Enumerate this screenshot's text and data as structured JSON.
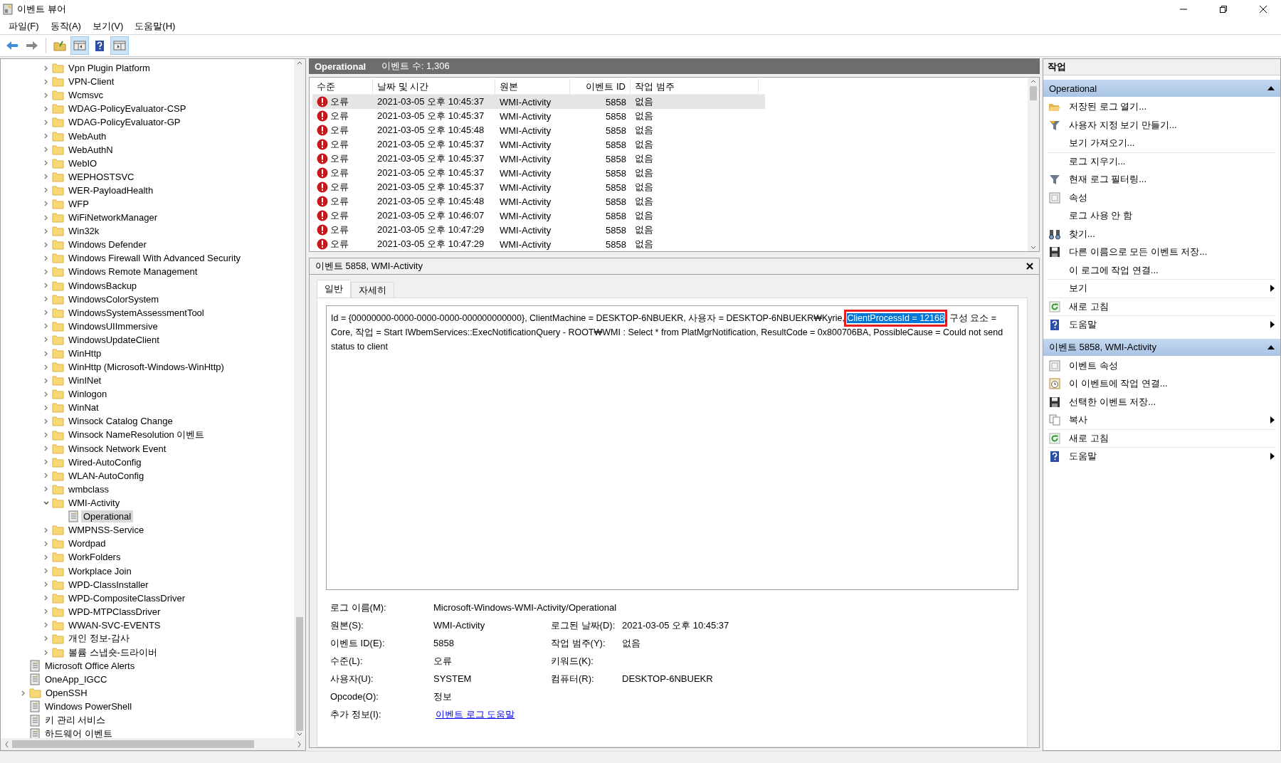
{
  "window": {
    "title": "이벤트 뷰어"
  },
  "menu": [
    "파일(F)",
    "동작(A)",
    "보기(V)",
    "도움말(H)"
  ],
  "toolbar": [
    {
      "kind": "back",
      "pressed": false
    },
    {
      "kind": "forward",
      "pressed": false
    },
    {
      "kind": "up",
      "pressed": false
    },
    {
      "kind": "tree-pane",
      "pressed": true
    },
    {
      "kind": "help",
      "pressed": false
    },
    {
      "kind": "action-pane",
      "pressed": true
    }
  ],
  "tree": {
    "nested_items": [
      {
        "label": "Vpn Plugin Platform",
        "kind": "folder",
        "expanded": false,
        "selected": false
      },
      {
        "label": "VPN-Client",
        "kind": "folder",
        "expanded": false,
        "selected": false
      },
      {
        "label": "Wcmsvc",
        "kind": "folder",
        "expanded": false,
        "selected": false
      },
      {
        "label": "WDAG-PolicyEvaluator-CSP",
        "kind": "folder",
        "expanded": false,
        "selected": false
      },
      {
        "label": "WDAG-PolicyEvaluator-GP",
        "kind": "folder",
        "expanded": false,
        "selected": false
      },
      {
        "label": "WebAuth",
        "kind": "folder",
        "expanded": false,
        "selected": false
      },
      {
        "label": "WebAuthN",
        "kind": "folder",
        "expanded": false,
        "selected": false
      },
      {
        "label": "WebIO",
        "kind": "folder",
        "expanded": false,
        "selected": false
      },
      {
        "label": "WEPHOSTSVC",
        "kind": "folder",
        "expanded": false,
        "selected": false
      },
      {
        "label": "WER-PayloadHealth",
        "kind": "folder",
        "expanded": false,
        "selected": false
      },
      {
        "label": "WFP",
        "kind": "folder",
        "expanded": false,
        "selected": false
      },
      {
        "label": "WiFiNetworkManager",
        "kind": "folder",
        "expanded": false,
        "selected": false
      },
      {
        "label": "Win32k",
        "kind": "folder",
        "expanded": false,
        "selected": false
      },
      {
        "label": "Windows Defender",
        "kind": "folder",
        "expanded": false,
        "selected": false
      },
      {
        "label": "Windows Firewall With Advanced Security",
        "kind": "folder",
        "expanded": false,
        "selected": false
      },
      {
        "label": "Windows Remote Management",
        "kind": "folder",
        "expanded": false,
        "selected": false
      },
      {
        "label": "WindowsBackup",
        "kind": "folder",
        "expanded": false,
        "selected": false
      },
      {
        "label": "WindowsColorSystem",
        "kind": "folder",
        "expanded": false,
        "selected": false
      },
      {
        "label": "WindowsSystemAssessmentTool",
        "kind": "folder",
        "expanded": false,
        "selected": false
      },
      {
        "label": "WindowsUIImmersive",
        "kind": "folder",
        "expanded": false,
        "selected": false
      },
      {
        "label": "WindowsUpdateClient",
        "kind": "folder",
        "expanded": false,
        "selected": false
      },
      {
        "label": "WinHttp",
        "kind": "folder",
        "expanded": false,
        "selected": false
      },
      {
        "label": "WinHttp (Microsoft-Windows-WinHttp)",
        "kind": "folder",
        "expanded": false,
        "selected": false
      },
      {
        "label": "WinINet",
        "kind": "folder",
        "expanded": false,
        "selected": false
      },
      {
        "label": "Winlogon",
        "kind": "folder",
        "expanded": false,
        "selected": false
      },
      {
        "label": "WinNat",
        "kind": "folder",
        "expanded": false,
        "selected": false
      },
      {
        "label": "Winsock Catalog Change",
        "kind": "folder",
        "expanded": false,
        "selected": false
      },
      {
        "label": "Winsock NameResolution 이벤트",
        "kind": "folder",
        "expanded": false,
        "selected": false
      },
      {
        "label": "Winsock Network Event",
        "kind": "folder",
        "expanded": false,
        "selected": false
      },
      {
        "label": "Wired-AutoConfig",
        "kind": "folder",
        "expanded": false,
        "selected": false
      },
      {
        "label": "WLAN-AutoConfig",
        "kind": "folder",
        "expanded": false,
        "selected": false
      },
      {
        "label": "wmbclass",
        "kind": "folder",
        "expanded": false,
        "selected": false
      },
      {
        "label": "WMI-Activity",
        "kind": "folder",
        "expanded": true,
        "selected": false,
        "children": [
          {
            "label": "Operational",
            "kind": "log",
            "selected": true
          }
        ]
      },
      {
        "label": "WMPNSS-Service",
        "kind": "folder",
        "expanded": false,
        "selected": false
      },
      {
        "label": "Wordpad",
        "kind": "folder",
        "expanded": false,
        "selected": false
      },
      {
        "label": "WorkFolders",
        "kind": "folder",
        "expanded": false,
        "selected": false
      },
      {
        "label": "Workplace Join",
        "kind": "folder",
        "expanded": false,
        "selected": false
      },
      {
        "label": "WPD-ClassInstaller",
        "kind": "folder",
        "expanded": false,
        "selected": false
      },
      {
        "label": "WPD-CompositeClassDriver",
        "kind": "folder",
        "expanded": false,
        "selected": false
      },
      {
        "label": "WPD-MTPClassDriver",
        "kind": "folder",
        "expanded": false,
        "selected": false
      },
      {
        "label": "WWAN-SVC-EVENTS",
        "kind": "folder",
        "expanded": false,
        "selected": false
      },
      {
        "label": "개인 정보-감사",
        "kind": "folder",
        "expanded": false,
        "selected": false
      },
      {
        "label": "볼륨 스냅숏-드라이버",
        "kind": "folder",
        "expanded": false,
        "selected": false
      }
    ],
    "items": [
      {
        "label": "Microsoft Office Alerts",
        "kind": "log",
        "selected": false
      },
      {
        "label": "OneApp_IGCC",
        "kind": "log",
        "selected": false
      },
      {
        "label": "OpenSSH",
        "kind": "folder",
        "expanded": false,
        "selected": false
      },
      {
        "label": "Windows PowerShell",
        "kind": "log",
        "selected": false
      },
      {
        "label": "키 관리 서비스",
        "kind": "log",
        "selected": false
      },
      {
        "label": "하드웨어 이벤트",
        "kind": "log",
        "selected": false
      }
    ]
  },
  "log_header": {
    "title": "Operational",
    "count": "이벤트 수: 1,306"
  },
  "event_table": {
    "columns": [
      "수준",
      "날짜 및 시간",
      "원본",
      "이벤트 ID",
      "작업 범주"
    ],
    "rows": [
      {
        "kind": "error",
        "level": "오류",
        "datetime": "2021-03-05 오후 10:45:37",
        "source": "WMI-Activity",
        "event_id": "5858",
        "category": "없음",
        "selected": true
      },
      {
        "kind": "error",
        "level": "오류",
        "datetime": "2021-03-05 오후 10:45:37",
        "source": "WMI-Activity",
        "event_id": "5858",
        "category": "없음",
        "selected": false
      },
      {
        "kind": "error",
        "level": "오류",
        "datetime": "2021-03-05 오후 10:45:48",
        "source": "WMI-Activity",
        "event_id": "5858",
        "category": "없음",
        "selected": false
      },
      {
        "kind": "error",
        "level": "오류",
        "datetime": "2021-03-05 오후 10:45:37",
        "source": "WMI-Activity",
        "event_id": "5858",
        "category": "없음",
        "selected": false
      },
      {
        "kind": "error",
        "level": "오류",
        "datetime": "2021-03-05 오후 10:45:37",
        "source": "WMI-Activity",
        "event_id": "5858",
        "category": "없음",
        "selected": false
      },
      {
        "kind": "error",
        "level": "오류",
        "datetime": "2021-03-05 오후 10:45:37",
        "source": "WMI-Activity",
        "event_id": "5858",
        "category": "없음",
        "selected": false
      },
      {
        "kind": "error",
        "level": "오류",
        "datetime": "2021-03-05 오후 10:45:37",
        "source": "WMI-Activity",
        "event_id": "5858",
        "category": "없음",
        "selected": false
      },
      {
        "kind": "error",
        "level": "오류",
        "datetime": "2021-03-05 오후 10:45:48",
        "source": "WMI-Activity",
        "event_id": "5858",
        "category": "없음",
        "selected": false
      },
      {
        "kind": "error",
        "level": "오류",
        "datetime": "2021-03-05 오후 10:46:07",
        "source": "WMI-Activity",
        "event_id": "5858",
        "category": "없음",
        "selected": false
      },
      {
        "kind": "error",
        "level": "오류",
        "datetime": "2021-03-05 오후 10:47:29",
        "source": "WMI-Activity",
        "event_id": "5858",
        "category": "없음",
        "selected": false
      },
      {
        "kind": "error",
        "level": "오류",
        "datetime": "2021-03-05 오후 10:47:29",
        "source": "WMI-Activity",
        "event_id": "5858",
        "category": "없음",
        "selected": false
      }
    ]
  },
  "detail": {
    "title": "이벤트 5858, WMI-Activity",
    "tabs": [
      {
        "label": "일반",
        "selected": true
      },
      {
        "label": "자세히",
        "selected": false
      }
    ],
    "message": {
      "text_before": "Id = {00000000-0000-0000-0000-000000000000}, ClientMachine = DESKTOP-6NBUEKR, 사용자 = DESKTOP-6NBUEKR₩Kyrie, ",
      "selected_text": "ClientProcessId = 12168",
      "text_after": ", 구성 요소 = Core, 작업 = Start IWbemServices::ExecNotificationQuery - ROOT₩WMI : Select * from PlatMgrNotification, ResultCode = 0x800706BA, PossibleCause = Could not send status to client",
      "outlined": true
    },
    "fields": [
      [
        {
          "label": "로그 이름(M):",
          "value": "Microsoft-Windows-WMI-Activity/Operational"
        }
      ],
      [
        {
          "label": "원본(S):",
          "value": "WMI-Activity"
        },
        {
          "label": "로그된 날짜(D):",
          "value": "2021-03-05 오후 10:45:37"
        }
      ],
      [
        {
          "label": "이벤트 ID(E):",
          "value": "5858"
        },
        {
          "label": "작업 범주(Y):",
          "value": "없음"
        }
      ],
      [
        {
          "label": "수준(L):",
          "value": "오류"
        },
        {
          "label": "키워드(K):"
        }
      ],
      [
        {
          "label": "사용자(U):",
          "value": "SYSTEM"
        },
        {
          "label": "컴퓨터(R):",
          "value": "DESKTOP-6NBUEKR"
        }
      ],
      [
        {
          "label": "Opcode(O):",
          "value": "정보"
        }
      ],
      [
        {
          "label": "추가 정보(I):",
          "value": "이벤트 로그 도움말",
          "kind": "link"
        }
      ]
    ]
  },
  "actions": {
    "title": "작업",
    "sections": [
      {
        "title": "Operational",
        "expanded": true,
        "items": [
          {
            "label": "저장된 로그 열기...",
            "kind": "open-folder",
            "submenu": false,
            "divider_after": false
          },
          {
            "label": "사용자 지정 보기 만들기...",
            "kind": "funnel-star",
            "submenu": false,
            "divider_after": false
          },
          {
            "label": "보기 가져오기...",
            "submenu": false,
            "divider_after": true
          },
          {
            "label": "로그 지우기...",
            "submenu": false,
            "divider_after": false
          },
          {
            "label": "현재 로그 필터링...",
            "kind": "funnel",
            "submenu": false,
            "divider_after": false
          },
          {
            "label": "속성",
            "kind": "properties",
            "submenu": false,
            "divider_after": false
          },
          {
            "label": "로그 사용 안 함",
            "submenu": false,
            "divider_after": false
          },
          {
            "label": "찾기...",
            "kind": "binoculars",
            "submenu": false,
            "divider_after": false
          },
          {
            "label": "다른 이름으로 모든 이벤트 저장...",
            "kind": "floppy",
            "submenu": false,
            "divider_after": false
          },
          {
            "label": "이 로그에 작업 연결...",
            "submenu": false,
            "divider_after": true
          },
          {
            "label": "보기",
            "submenu": true,
            "divider_after": true
          },
          {
            "label": "새로 고침",
            "kind": "refresh",
            "submenu": false,
            "divider_after": true
          },
          {
            "label": "도움말",
            "kind": "help",
            "submenu": true,
            "divider_after": false
          }
        ]
      },
      {
        "title": "이벤트 5858, WMI-Activity",
        "expanded": true,
        "items": [
          {
            "label": "이벤트 속성",
            "kind": "properties",
            "submenu": false,
            "divider_after": false
          },
          {
            "label": "이 이벤트에 작업 연결...",
            "kind": "clock",
            "submenu": false,
            "divider_after": false
          },
          {
            "label": "선택한 이벤트 저장...",
            "kind": "floppy",
            "submenu": false,
            "divider_after": false
          },
          {
            "label": "복사",
            "kind": "copy",
            "submenu": true,
            "divider_after": true
          },
          {
            "label": "새로 고침",
            "kind": "refresh",
            "submenu": false,
            "divider_after": true
          },
          {
            "label": "도움말",
            "kind": "help",
            "submenu": true,
            "divider_after": false
          }
        ]
      }
    ]
  }
}
